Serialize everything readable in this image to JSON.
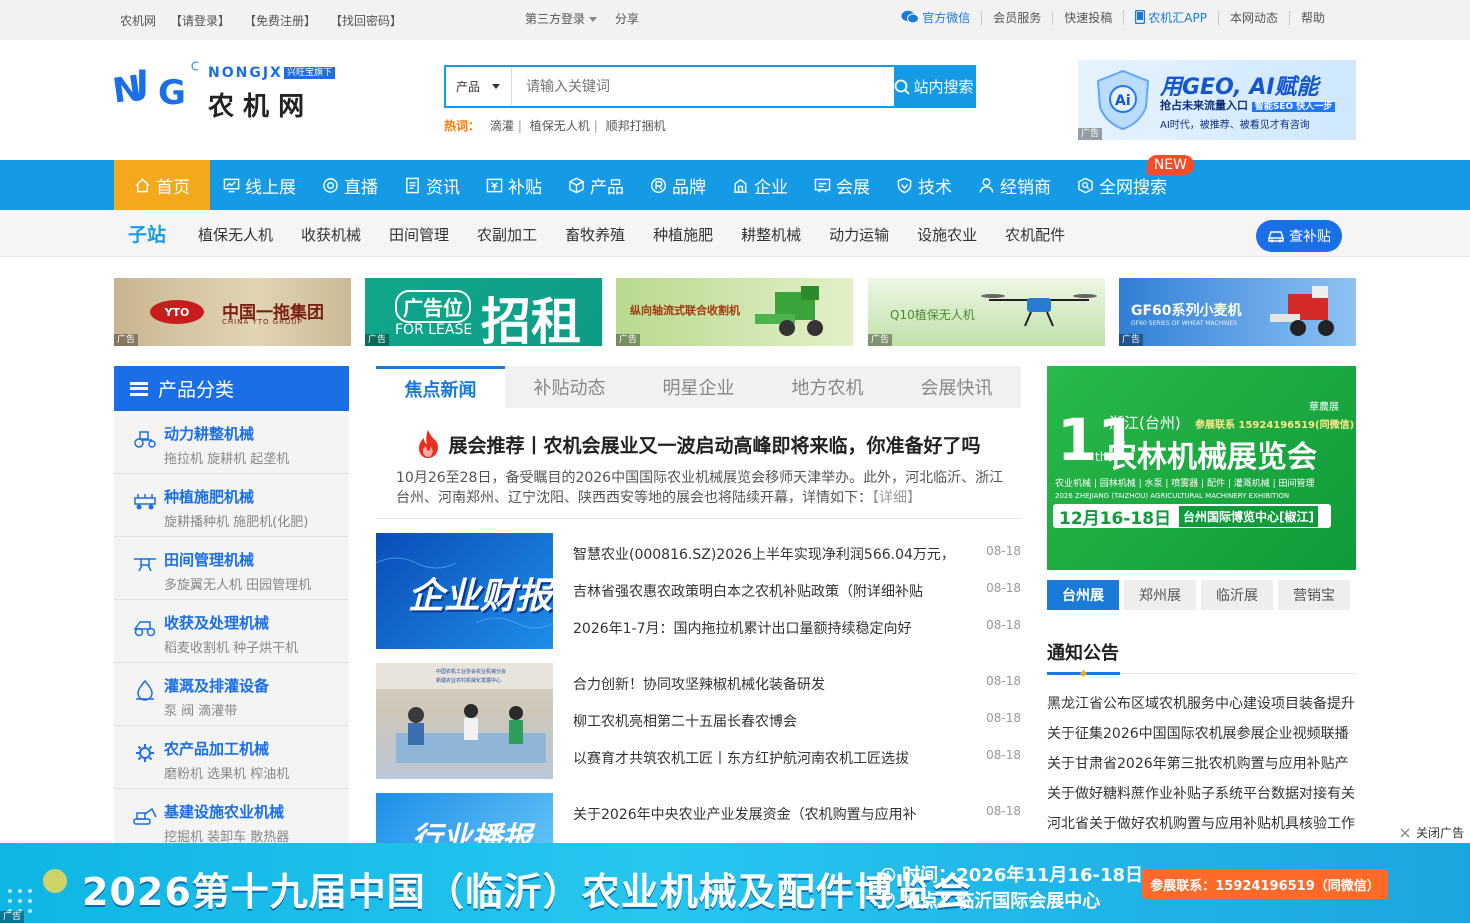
{
  "topbar": {
    "left_links": [
      "农机网",
      "【请登录】",
      "【免费注册】",
      "【找回密码】"
    ],
    "third_party_login": "第三方登录",
    "share": "分享",
    "right_links": [
      {
        "label": "官方微信",
        "highlight": true
      },
      {
        "label": "会员服务",
        "highlight": false
      },
      {
        "label": "快速投稿",
        "highlight": false
      },
      {
        "label": "农机汇APP",
        "highlight": true
      },
      {
        "label": "本网动态",
        "highlight": false
      },
      {
        "label": "帮助",
        "highlight": false
      }
    ]
  },
  "logo": {
    "brand_en": "NONGJX",
    "tag": "兴旺宝旗下",
    "brand_cn": "农 机 网",
    "mark": "NJG"
  },
  "search": {
    "category": "产品",
    "placeholder": "请输入关键词",
    "button": "站内搜索"
  },
  "hotwords": {
    "label": "热词：",
    "items": [
      "滴灌",
      "植保无人机",
      "顺邦打捆机"
    ]
  },
  "header_ad": {
    "title": "用GEO, AI赋能",
    "line2": "抢占未来流量入口",
    "tag": "智能SEO 快人一步",
    "line3": "AI时代，被推荐、被看见才有咨询",
    "ad_label": "广告"
  },
  "main_nav": {
    "items": [
      {
        "label": "首页",
        "icon": "home-icon",
        "active": true
      },
      {
        "label": "线上展",
        "icon": "monitor-icon"
      },
      {
        "label": "直播",
        "icon": "live-icon"
      },
      {
        "label": "资讯",
        "icon": "document-icon"
      },
      {
        "label": "补贴",
        "icon": "subsidy-icon"
      },
      {
        "label": "产品",
        "icon": "cube-icon"
      },
      {
        "label": "品牌",
        "icon": "registered-icon"
      },
      {
        "label": "企业",
        "icon": "building-icon"
      },
      {
        "label": "会展",
        "icon": "exhibition-icon"
      },
      {
        "label": "技术",
        "icon": "shield-icon"
      },
      {
        "label": "经销商",
        "icon": "user-icon"
      },
      {
        "label": "全网搜索",
        "icon": "search-box-icon"
      }
    ],
    "new_badge": "NEW"
  },
  "sub_nav": {
    "label": "子站",
    "items": [
      "植保无人机",
      "收获机械",
      "田间管理",
      "农副加工",
      "畜牧养殖",
      "种植施肥",
      "耕整机械",
      "动力运输",
      "设施农业",
      "农机配件"
    ],
    "subsidy_button": "查补贴"
  },
  "banners": [
    {
      "text": "中国一拖集团",
      "sub": "CHINA YTO GROUP",
      "logo": "YTO",
      "ad_label": "广告"
    },
    {
      "text": "招租",
      "sub": "FOR LEASE",
      "tag": "广告位",
      "ad_label": "广告"
    },
    {
      "text": "纵向轴流式联合收割机",
      "ad_label": "广告"
    },
    {
      "text": "Q10植保无人机",
      "ad_label": "广告"
    },
    {
      "text": "GF60系列小麦机",
      "sub": "GF60 SERIES OF WHEAT MACHINES",
      "ad_label": "广告"
    }
  ],
  "product_categories": {
    "title": "产品分类",
    "items": [
      {
        "title": "动力耕整机械",
        "sub": "拖拉机 旋耕机 起垄机",
        "icon": "tractor-icon"
      },
      {
        "title": "种植施肥机械",
        "sub": "旋耕播种机 施肥机(化肥)",
        "icon": "seeder-icon"
      },
      {
        "title": "田间管理机械",
        "sub": "多旋翼无人机 田园管理机",
        "icon": "drone-icon"
      },
      {
        "title": "收获及处理机械",
        "sub": "稻麦收割机 种子烘干机",
        "icon": "harvester-icon"
      },
      {
        "title": "灌溉及排灌设备",
        "sub": "泵 阀 滴灌带",
        "icon": "water-drop-icon"
      },
      {
        "title": "农产品加工机械",
        "sub": "磨粉机 选果机 榨油机",
        "icon": "gear-icon"
      },
      {
        "title": "基建设施农业机械",
        "sub": "挖掘机 装卸车 散热器",
        "icon": "excavator-icon"
      }
    ]
  },
  "news": {
    "tabs": [
      "焦点新闻",
      "补贴动态",
      "明星企业",
      "地方农机",
      "会展快讯"
    ],
    "headline": "展会推荐丨农机会展业又一波启动高峰即将来临，你准备好了吗",
    "summary": "10月26至28日，备受瞩目的2026中国国际农业机械展览会移师天津举办。此外，河北临沂、浙江台州、河南郑州、辽宁沈阳、陕西西安等地的展会也将陆续开幕，详情如下：",
    "more": "【详细】",
    "thumbs": [
      {
        "text": "企业财报"
      },
      {
        "text": "中国农机工业协会农业机械分会",
        "caption": "新疆农业农村机械化发展中心"
      },
      {
        "text": "行业播报"
      }
    ],
    "items": [
      {
        "title": "智慧农业(000816.SZ)2026上半年实现净利润566.04万元，",
        "date": "08-18"
      },
      {
        "title": "吉林省强农惠农政策明白本之农机补贴政策（附详细补贴",
        "date": "08-18"
      },
      {
        "title": "2026年1-7月：国内拖拉机累计出口量额持续稳定向好",
        "date": "08-18"
      },
      {
        "title": "合力创新！协同攻坚辣椒机械化装备研发",
        "date": "08-18"
      },
      {
        "title": "柳工农机亮相第二十五届长春农博会",
        "date": "08-18"
      },
      {
        "title": "以赛育才共筑农机工匠丨东方红护航河南农机工匠选拔",
        "date": "08-18"
      },
      {
        "title": "关于2026年中央农业产业发展资金（农机购置与应用补",
        "date": "08-18"
      }
    ]
  },
  "expo_ad": {
    "num": "11",
    "place": "浙江(台州)",
    "contact": "参展联系 15924196519(同微信)",
    "brand": "華農展",
    "title": "农林机械展览会",
    "categories": "农业机械 | 园林机械 | 水泵 | 喷雾器 | 配件 | 灌溉机械 | 田间管理",
    "en": "2026 ZHEJIANG (TAIZHOU) AGRICULTURAL MACHINERY EXHIBITION",
    "date": "12月16-18日",
    "venue": "台州国际博览中心[椒江]"
  },
  "expo_tabs": [
    "台州展",
    "郑州展",
    "临沂展",
    "营销宝"
  ],
  "notices": {
    "title": "通知公告",
    "items": [
      "黑龙江省公布区域农机服务中心建设项目装备提升",
      "关于征集2026中国国际农机展参展企业视频联播",
      "关于甘肃省2026年第三批农机购置与应用补贴产",
      "关于做好糖料蔗作业补贴子系统平台数据对接有关",
      "河北省关于做好农机购置与应用补贴机具核验工作"
    ]
  },
  "floating_ad": {
    "close_label": "关闭广告",
    "title": "2026第十九届中国（临沂）农业机械及配件博览会",
    "time": "时间：2026年11月16-18日",
    "place": "地点：临沂国际会展中心",
    "contact": "参展联系：15924196519（同微信）",
    "ad_label": "广告"
  },
  "colors": {
    "primary": "#159be6",
    "accent": "#f4a81c",
    "brand_blue": "#1a6fe6",
    "hot": "#ff7a00"
  }
}
